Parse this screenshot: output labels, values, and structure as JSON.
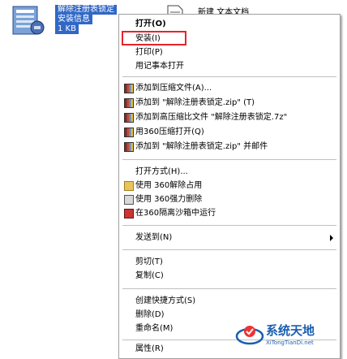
{
  "desktop": {
    "reg_file": {
      "name_line1": "解除注册表锁定",
      "name_line2": "安装信息",
      "name_line3": "1 KB"
    },
    "txt_file": {
      "name": "新建 文本文档"
    }
  },
  "menu": {
    "items": [
      {
        "label": "打开(O)",
        "bold": true
      },
      {
        "label": "安装(I)",
        "highlighted": true
      },
      {
        "label": "打印(P)"
      },
      {
        "label": "用记事本打开"
      },
      {
        "label": "添加到压缩文件(A)...",
        "icon": "zip-icon"
      },
      {
        "label": "添加到 \"解除注册表锁定.zip\" (T)",
        "icon": "zip-icon"
      },
      {
        "label": "添加到高压缩比文件 \"解除注册表锁定.7z\"",
        "icon": "zip-icon"
      },
      {
        "label": "用360压缩打开(Q)",
        "icon": "zip-icon"
      },
      {
        "label": "添加到 \"解除注册表锁定.zip\" 并邮件",
        "icon": "zip-icon"
      },
      {
        "label": "打开方式(H)..."
      },
      {
        "label": "使用 360解除占用",
        "icon": "folder-icon"
      },
      {
        "label": "使用 360强力删除",
        "icon": "shred-icon"
      },
      {
        "label": "在360隔离沙箱中运行",
        "icon": "sandbox-icon"
      },
      {
        "label": "发送到(N)",
        "submenu": true
      },
      {
        "label": "剪切(T)"
      },
      {
        "label": "复制(C)"
      },
      {
        "label": "创建快捷方式(S)"
      },
      {
        "label": "删除(D)"
      },
      {
        "label": "重命名(M)"
      },
      {
        "label": "属性(R)"
      }
    ]
  },
  "watermark": {
    "title": "系统天地",
    "url": "XiTongTianDi.net"
  },
  "colors": {
    "selection": "#3168c6",
    "highlight_box": "#e8232b",
    "watermark": "#1a5fb0"
  }
}
